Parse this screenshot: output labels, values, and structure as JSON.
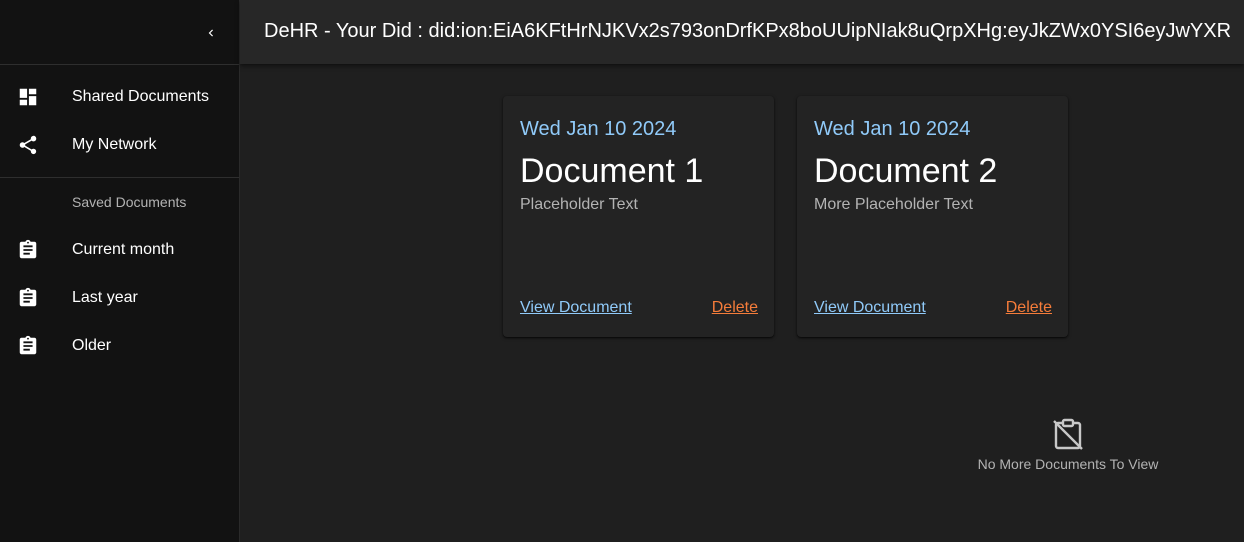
{
  "header": {
    "title": "DeHR - Your Did : did:ion:EiA6KFtHrNJKVx2s793onDrfKPx8boUUipNIak8uQrpXHg:eyJkZWx0YSI6eyJwYXR"
  },
  "sidebar": {
    "collapse_icon": "chevron-left-icon",
    "nav_items": [
      {
        "label": "Shared Documents",
        "icon": "dashboard-icon"
      },
      {
        "label": "My Network",
        "icon": "share-icon"
      }
    ],
    "saved_header": "Saved Documents",
    "saved_items": [
      {
        "label": "Current month",
        "icon": "clipboard-icon"
      },
      {
        "label": "Last year",
        "icon": "clipboard-icon"
      },
      {
        "label": "Older",
        "icon": "clipboard-icon"
      }
    ]
  },
  "cards": [
    {
      "date": "Wed Jan 10 2024",
      "title": "Document 1",
      "subtitle": "Placeholder Text",
      "view_label": "View Document",
      "delete_label": "Delete"
    },
    {
      "date": "Wed Jan 10 2024",
      "title": "Document 2",
      "subtitle": "More Placeholder Text",
      "view_label": "View Document",
      "delete_label": "Delete"
    }
  ],
  "empty_state": {
    "icon": "clipboard-off-icon",
    "text": "No More Documents To View"
  },
  "colors": {
    "accent": "#90caf9",
    "danger": "#f57c3a",
    "background": "#1f1f1f",
    "sidebar": "#121212"
  }
}
